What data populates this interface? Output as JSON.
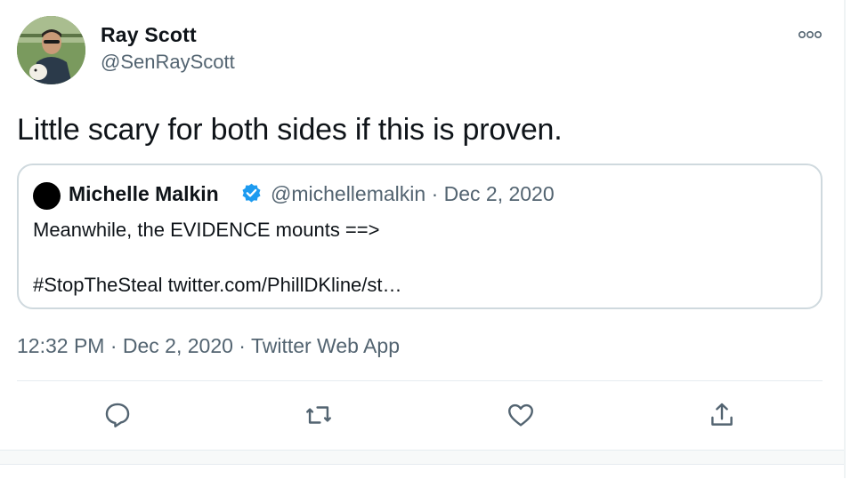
{
  "author": {
    "name": "Ray Scott",
    "handle": "@SenRayScott"
  },
  "tweet": {
    "text": "Little scary for both sides if this is proven.",
    "timestamp": "12:32 PM · Dec 2, 2020 · Twitter Web App"
  },
  "quote": {
    "name": "Michelle Malkin",
    "handle": "@michellemalkin",
    "date": "Dec 2, 2020",
    "meta": "@michellemalkin · Dec 2, 2020",
    "line1": "Meanwhile, the EVIDENCE mounts ==>",
    "line2": "#StopTheSteal twitter.com/PhillDKline/st…"
  },
  "icons": {
    "more": "more-horizontal-icon",
    "verified": "verified-badge-icon",
    "reply": "reply-icon",
    "retweet": "retweet-icon",
    "like": "heart-icon",
    "share": "share-icon"
  },
  "colors": {
    "verified": "#1d9bf0",
    "secondary_text": "#536471",
    "border": "#cfd9de"
  }
}
